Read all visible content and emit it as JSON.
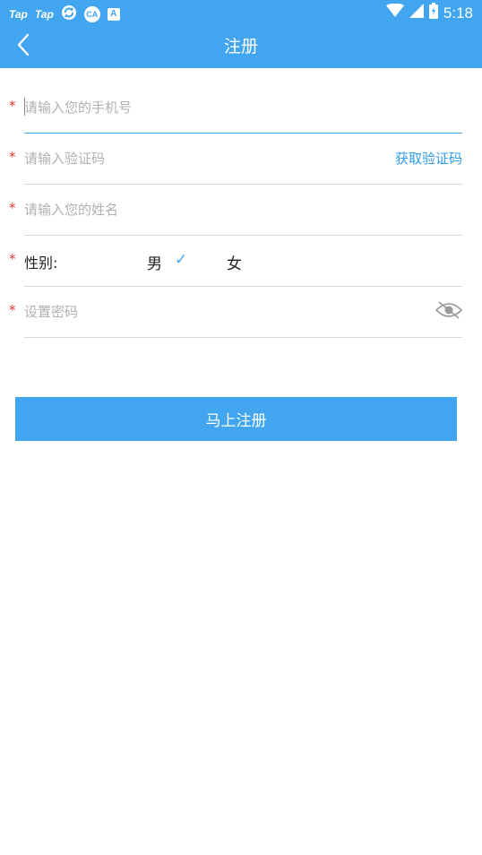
{
  "status_bar": {
    "app_icon_1": "Tap",
    "app_icon_2": "Tap",
    "app_icon_4": "CA",
    "app_icon_5": "A",
    "time": "5:18"
  },
  "header": {
    "title": "注册"
  },
  "form": {
    "phone_placeholder": "请输入您的手机号",
    "code_placeholder": "请输入验证码",
    "get_code_label": "获取验证码",
    "name_placeholder": "请输入您的姓名",
    "gender_label": "性别:",
    "gender_male": "男",
    "gender_female": "女",
    "selected_gender": "男",
    "check_mark": "✓",
    "password_placeholder": "设置密码",
    "required_mark": "*"
  },
  "submit_label": "马上注册",
  "colors": {
    "primary": "#42a5f0",
    "required": "#e53935",
    "link": "#2f9be8"
  },
  "icons": {
    "back": "chevron-left-icon",
    "password_visibility": "eye-off-icon",
    "wifi": "wifi-icon",
    "signal": "signal-icon",
    "battery": "battery-icon"
  }
}
